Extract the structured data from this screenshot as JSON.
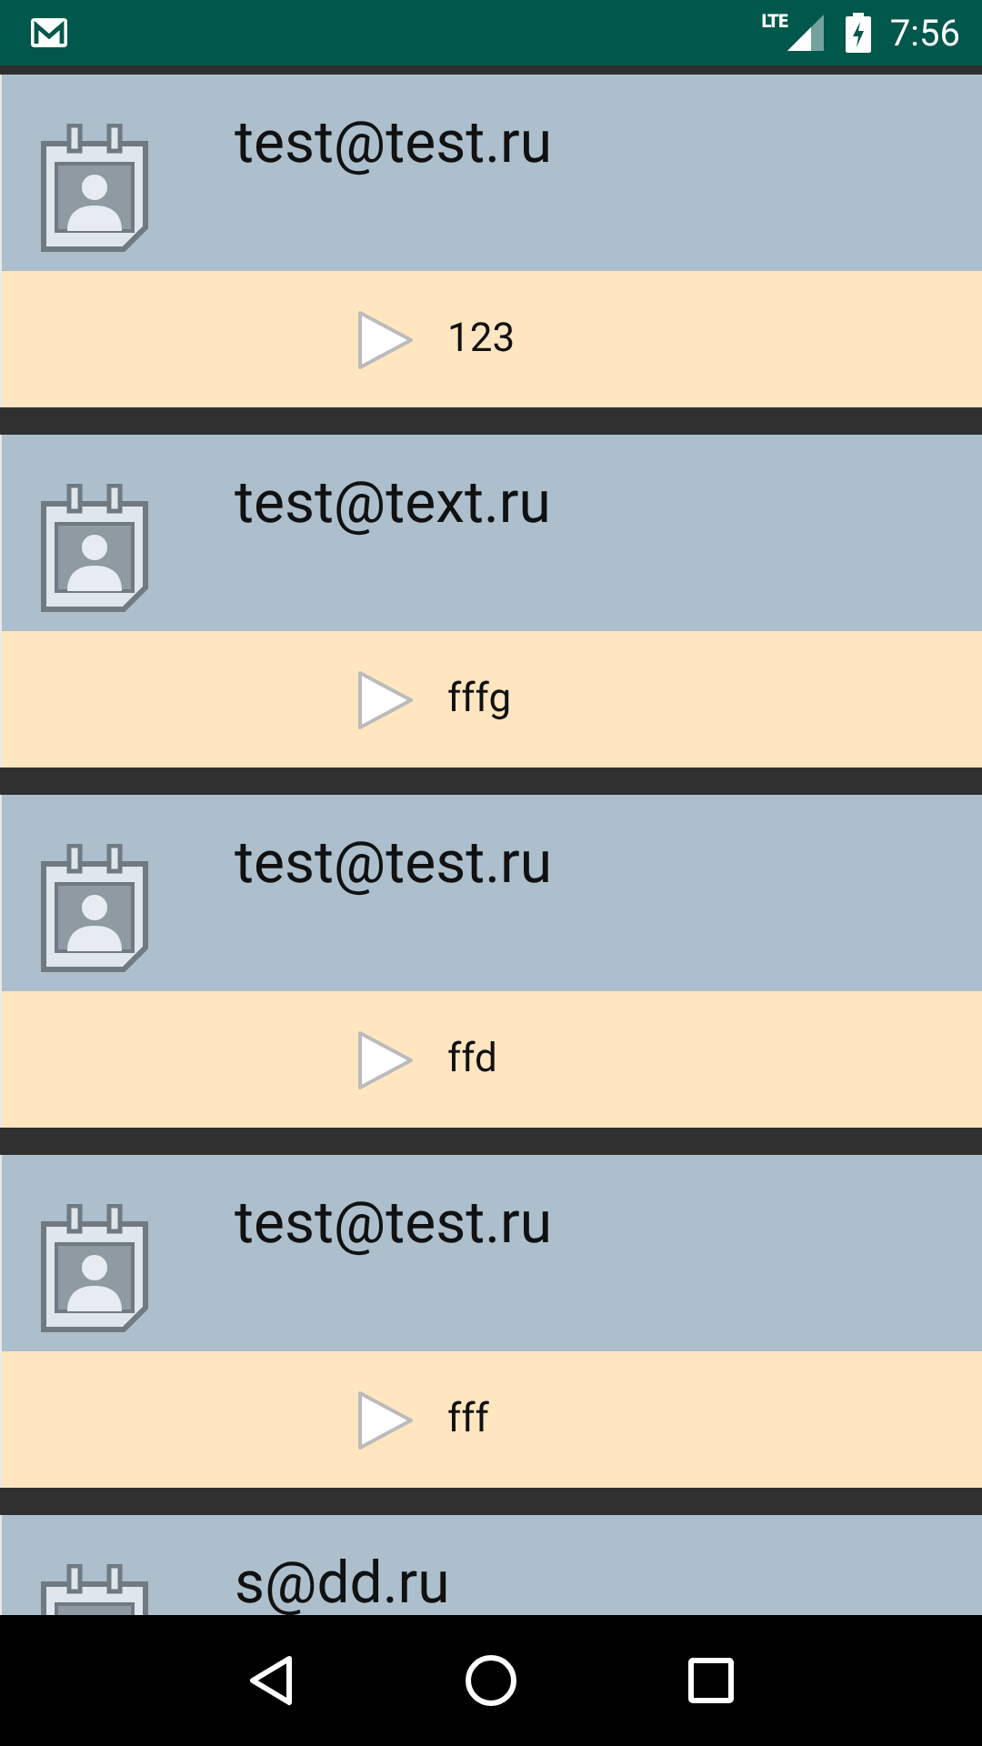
{
  "status_bar": {
    "network": "LTE",
    "time": "7:56"
  },
  "items": [
    {
      "email": "test@test.ru",
      "message": "123"
    },
    {
      "email": "test@text.ru",
      "message": "fffg"
    },
    {
      "email": "test@test.ru",
      "message": "ffd"
    },
    {
      "email": "test@test.ru",
      "message": "fff"
    },
    {
      "email": "s@dd.ru"
    }
  ]
}
